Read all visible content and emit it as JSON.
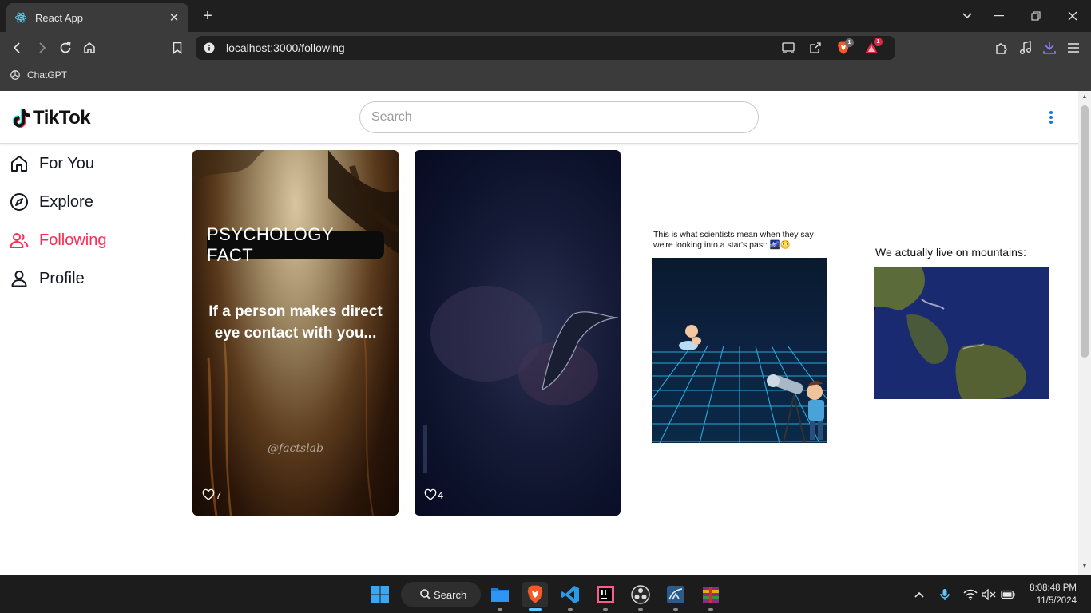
{
  "browser": {
    "tab_title": "React App",
    "url": "localhost:3000/following",
    "bookmark_label": "ChatGPT",
    "brave_shields_count": "1",
    "rewards_count": "1"
  },
  "app": {
    "logo_text": "TikTok",
    "search_placeholder": "Search",
    "nav": [
      {
        "label": "For You",
        "icon": "home-icon",
        "active": false
      },
      {
        "label": "Explore",
        "icon": "compass-icon",
        "active": false
      },
      {
        "label": "Following",
        "icon": "users-icon",
        "active": true
      },
      {
        "label": "Profile",
        "icon": "user-icon",
        "active": false
      }
    ],
    "accent_color": "#fe2c55",
    "videos": [
      {
        "title": "PSYCHOLOGY FACT",
        "text": "If a person makes direct eye contact with you...",
        "watermark": "@factslab",
        "likes": "7"
      },
      {
        "likes": "4"
      }
    ],
    "memes": [
      {
        "caption": "This is what scientists mean when they say we're looking into a star's past: 🌌😳"
      },
      {
        "caption": "We actually live on mountains:"
      }
    ]
  },
  "taskbar": {
    "search_label": "Search",
    "time": "8:08:48 PM",
    "date": "11/5/2024"
  }
}
